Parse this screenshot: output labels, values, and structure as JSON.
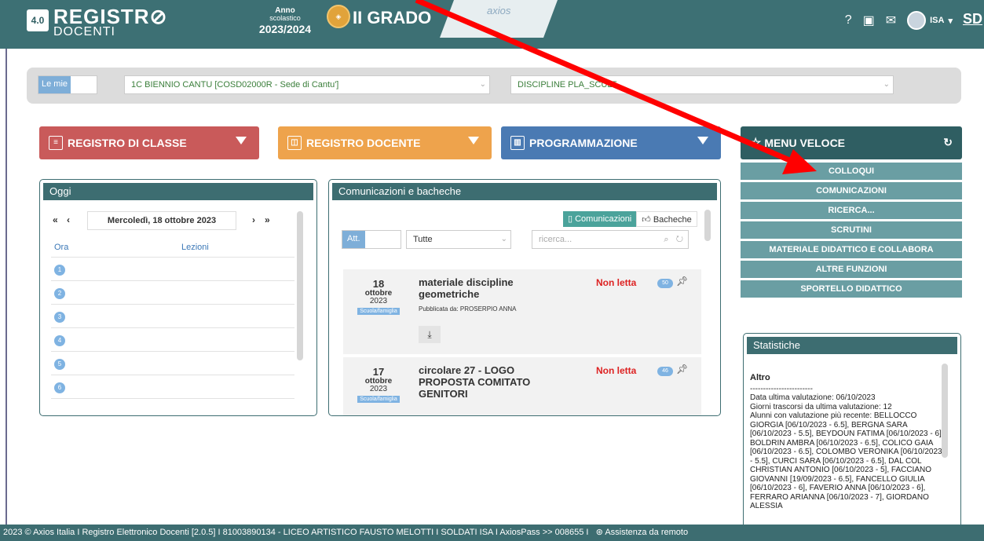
{
  "header": {
    "logo_icon": "4.0",
    "logo_line1": "REGISTR⊘",
    "logo_line2": "DOCENTI",
    "anno_line1": "Anno",
    "anno_line2": "scolastico",
    "anno_value": "2023/2024",
    "grado": "II GRADO",
    "axios": "axios",
    "user": "ISA",
    "corner": "SD"
  },
  "filters": {
    "lemie": "Le mie",
    "classe": "1C BIENNIO CANTU [COSD02000R - Sede di Cantu']",
    "disciplina": "DISCIPLINE PLA_SCULT"
  },
  "menu": {
    "registro_classe": "REGISTRO DI CLASSE",
    "registro_docente": "REGISTRO DOCENTE",
    "programmazione": "PROGRAMMAZIONE",
    "menu_veloce": "MENU VELOCE"
  },
  "quick_menu": [
    "COLLOQUI",
    "COMUNICAZIONI",
    "RICERCA...",
    "SCRUTINI",
    "MATERIALE DIDATTICO E COLLABORA",
    "ALTRE FUNZIONI",
    "SPORTELLO DIDATTICO"
  ],
  "oggi": {
    "title": "Oggi",
    "date": "Mercoledì, 18 ottobre 2023",
    "col_ora": "Ora",
    "col_lezioni": "Lezioni",
    "hours": [
      "1",
      "2",
      "3",
      "4",
      "5",
      "6"
    ]
  },
  "comunicazioni": {
    "title": "Comunicazioni e bacheche",
    "tab_com": "Comunicazioni",
    "tab_bach": "Bacheche",
    "att": "Att.",
    "filter": "Tutte",
    "search_placeholder": "ricerca...",
    "items": [
      {
        "day": "18",
        "month": "ottobre",
        "year": "2023",
        "tag": "Scuola/famiglia",
        "title": "materiale discipline geometriche",
        "published": "Pubblicata da: PROSERPIO ANNA",
        "status": "Non letta",
        "count": "50"
      },
      {
        "day": "17",
        "month": "ottobre",
        "year": "2023",
        "tag": "Scuola/famiglia",
        "title": "circolare 27 - LOGO PROPOSTA COMITATO GENITORI",
        "published": "",
        "status": "Non letta",
        "count": "46"
      }
    ]
  },
  "statistiche": {
    "title": "Statistiche",
    "section": "Altro",
    "divider": "------------------------",
    "line1": "Data ultima valutazione: 06/10/2023",
    "line2": "Giorni trascorsi da ultima valutazione: 12",
    "line3": "Alunni con valutazione più recente: BELLOCCO GIORGIA [06/10/2023 - 6.5], BERGNA SARA [06/10/2023 - 5.5], BEYDOUN FATIMA [06/10/2023 - 6], BOLDRIN AMBRA [06/10/2023 - 6.5], COLICO GAIA [06/10/2023 - 6.5], COLOMBO VERONIKA [06/10/2023 - 5.5], CURCI SARA [06/10/2023 - 6.5], DAL COL CHRISTIAN ANTONIO [06/10/2023 - 5], FACCIANO GIOVANNI [19/09/2023 - 6.5], FANCELLO GIULIA [06/10/2023 - 6], FAVERIO ANNA [06/10/2023 - 6], FERRARO ARIANNA [06/10/2023 - 7], GIORDANO ALESSIA"
  },
  "footer": {
    "text": "2023 © Axios Italia I  Registro Elettronico Docenti [2.0.5] I  81003890134 - LICEO ARTISTICO FAUSTO MELOTTI I  SOLDATI ISA I  AxiosPass >> 008655 I",
    "assist": "Assistenza da remoto"
  },
  "colors": {
    "header": "#3d7074",
    "red_button": "#c95a5a",
    "orange_button": "#eea34c",
    "blue_button": "#4a7ab3",
    "teal_dark": "#2f5e62",
    "quick_item": "#6a9ea3",
    "arrow": "#ff0000"
  },
  "icons": [
    "help-icon",
    "card-icon",
    "mail-icon",
    "avatar",
    "chevron-down-icon",
    "history-icon",
    "star-icon",
    "pin-icon",
    "download-icon",
    "search-icon",
    "refresh-icon",
    "bookmark-icon",
    "thumb-up-icon"
  ]
}
